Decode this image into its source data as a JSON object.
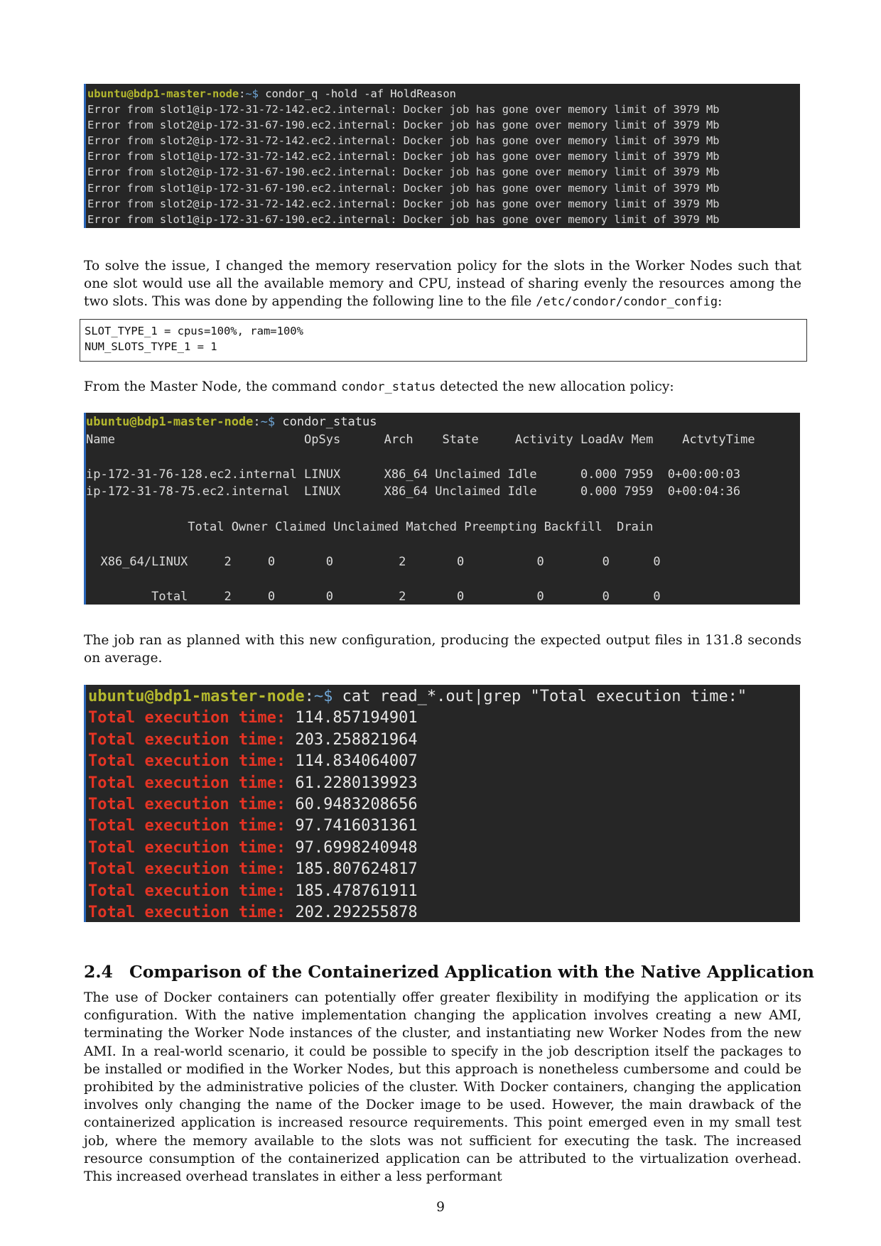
{
  "terminal1": {
    "prompt_user": "ubuntu@bdp1-master-node",
    "prompt_sep": ":",
    "prompt_path": "~$",
    "command": " condor_q -hold -af HoldReason",
    "lines": [
      "Error from slot1@ip-172-31-72-142.ec2.internal: Docker job has gone over memory limit of 3979 Mb",
      "Error from slot2@ip-172-31-67-190.ec2.internal: Docker job has gone over memory limit of 3979 Mb",
      "Error from slot2@ip-172-31-72-142.ec2.internal: Docker job has gone over memory limit of 3979 Mb",
      "Error from slot1@ip-172-31-72-142.ec2.internal: Docker job has gone over memory limit of 3979 Mb",
      "Error from slot2@ip-172-31-67-190.ec2.internal: Docker job has gone over memory limit of 3979 Mb",
      "Error from slot1@ip-172-31-67-190.ec2.internal: Docker job has gone over memory limit of 3979 Mb",
      "Error from slot2@ip-172-31-72-142.ec2.internal: Docker job has gone over memory limit of 3979 Mb",
      "Error from slot1@ip-172-31-67-190.ec2.internal: Docker job has gone over memory limit of 3979 Mb"
    ]
  },
  "para1": {
    "text_a": "To solve the issue, I changed the memory reservation policy for the slots in the Worker Nodes such that one slot would use all the available memory and CPU, instead of sharing evenly the resources among the two slots. This was done by appending the following line to the file ",
    "code": "/etc/condor/condor_config",
    "text_b": ":"
  },
  "codebox": {
    "lines": [
      "SLOT_TYPE_1 = cpus=100%, ram=100%",
      "NUM_SLOTS_TYPE_1 = 1"
    ]
  },
  "para2": {
    "text_a": "From the Master Node, the command ",
    "code": "condor_status",
    "text_b": " detected the new allocation policy:"
  },
  "terminal2": {
    "prompt_user": "ubuntu@bdp1-master-node",
    "prompt_sep": ":",
    "prompt_path": "~$",
    "command": " condor_status",
    "lines": [
      "Name                          OpSys      Arch    State     Activity LoadAv Mem    ActvtyTime",
      "",
      "ip-172-31-76-128.ec2.internal LINUX      X86_64 Unclaimed Idle      0.000 7959  0+00:00:03",
      "ip-172-31-78-75.ec2.internal  LINUX      X86_64 Unclaimed Idle      0.000 7959  0+00:04:36",
      "",
      "              Total Owner Claimed Unclaimed Matched Preempting Backfill  Drain",
      "",
      "  X86_64/LINUX     2     0       0         2       0          0        0      0",
      "",
      "         Total     2     0       0         2       0          0        0      0"
    ]
  },
  "para3": {
    "text": "The job ran as planned with this new configuration, producing the expected output files in 131.8 seconds on average."
  },
  "terminal3": {
    "prompt_user": "ubuntu@bdp1-master-node",
    "prompt_sep": ":",
    "prompt_path": "~$",
    "command": " cat read_*.out|grep \"Total execution time:\"",
    "label": "Total execution time:",
    "values": [
      "114.857194901",
      "203.258821964",
      "114.834064007",
      "61.2280139923",
      "60.9483208656",
      "97.7416031361",
      "97.6998240948",
      "185.807624817",
      "185.478761911",
      "202.292255878"
    ]
  },
  "section": {
    "number": "2.4",
    "title": "Comparison of the Containerized Application with the Native Application"
  },
  "para4": {
    "text": "The use of Docker containers can potentially offer greater flexibility in modifying the application or its configuration. With the native implementation changing the application involves creating a new AMI, terminating the Worker Node instances of the cluster, and instantiating new Worker Nodes from the new AMI. In a real-world scenario, it could be possible to specify in the job description itself the packages to be installed or modified in the Worker Nodes, but this approach is nonetheless cumbersome and could be prohibited by the administrative policies of the cluster. With Docker containers, changing the application involves only changing the name of the Docker image to be used. However, the main drawback of the containerized application is increased resource requirements. This point emerged even in my small test job, where the memory available to the slots was not sufficient for executing the task. The increased resource consumption of the containerized application can be attributed to the virtualization overhead. This increased overhead translates in either a less performant"
  },
  "page_number": "9"
}
